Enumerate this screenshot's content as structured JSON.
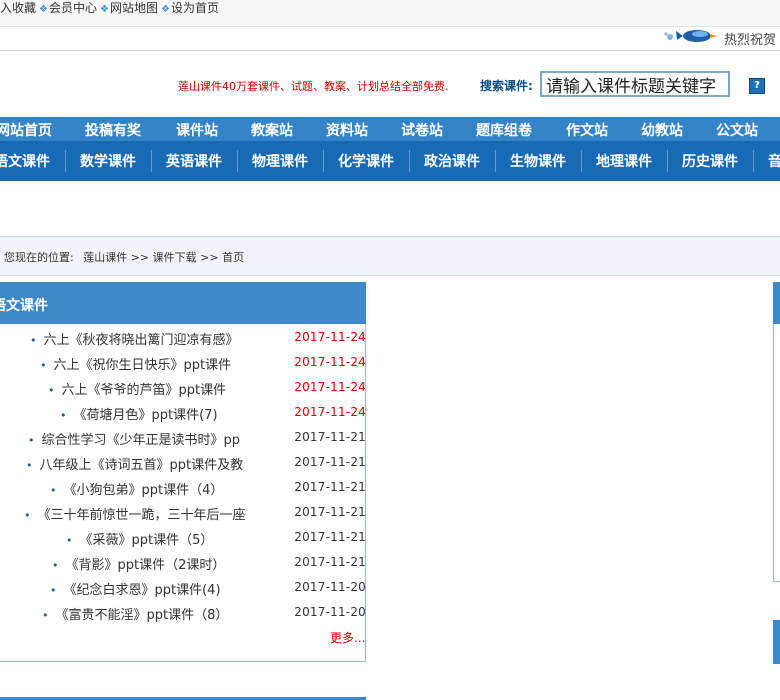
{
  "toplinks": [
    "加入收藏",
    "会员中心",
    "网站地图",
    "设为首页"
  ],
  "greeting": "热烈祝贺",
  "promo": "莲山课件40万套课件、试题、教案、计划总结全部免费.",
  "search": {
    "label": "搜索课件:",
    "value": "请输入课件标题关键字",
    "help": "?"
  },
  "nav_primary": [
    "网站首页",
    "投稿有奖",
    "课件站",
    "教案站",
    "资料站",
    "试卷站",
    "题库组卷",
    "作文站",
    "幼教站",
    "公文站"
  ],
  "nav_secondary": [
    "语文课件",
    "数学课件",
    "英语课件",
    "物理课件",
    "化学课件",
    "政治课件",
    "生物课件",
    "地理课件",
    "历史课件",
    "音"
  ],
  "breadcrumb": {
    "prefix": "您现在的位置:",
    "path": "莲山课件 >> 课件下载 >> 首页"
  },
  "panel": {
    "title": "语文课件",
    "items": [
      {
        "title": "六上《秋夜将晓出篱门迎凉有感》",
        "date": "2017-11-24",
        "highlight": true
      },
      {
        "title": "六上《祝你生日快乐》ppt课件",
        "date": "2017-11-24",
        "highlight": true
      },
      {
        "title": "六上《爷爷的芦笛》ppt课件",
        "date": "2017-11-24",
        "highlight": true
      },
      {
        "title": "《荷塘月色》ppt课件(7)",
        "date": "2017-11-24",
        "highlight": true
      },
      {
        "title": "综合性学习《少年正是读书时》pp",
        "date": "2017-11-21",
        "highlight": false
      },
      {
        "title": "八年级上《诗词五首》ppt课件及教",
        "date": "2017-11-21",
        "highlight": false
      },
      {
        "title": "《小狗包弟》ppt课件（4）",
        "date": "2017-11-21",
        "highlight": false
      },
      {
        "title": "《三十年前惊世一跪，三十年后一座",
        "date": "2017-11-21",
        "highlight": false
      },
      {
        "title": "《采薇》ppt课件（5）",
        "date": "2017-11-21",
        "highlight": false
      },
      {
        "title": "《背影》ppt课件（2课时）",
        "date": "2017-11-21",
        "highlight": false
      },
      {
        "title": "《纪念白求恩》ppt课件(4)",
        "date": "2017-11-20",
        "highlight": false
      },
      {
        "title": "《富贵不能淫》ppt课件（8）",
        "date": "2017-11-20",
        "highlight": false
      }
    ],
    "more": "更多..."
  },
  "colors": {
    "accent": "#176ab3",
    "nav_top": "#3584c7",
    "highlight_date": "#d40000",
    "normal_date": "#333333"
  }
}
